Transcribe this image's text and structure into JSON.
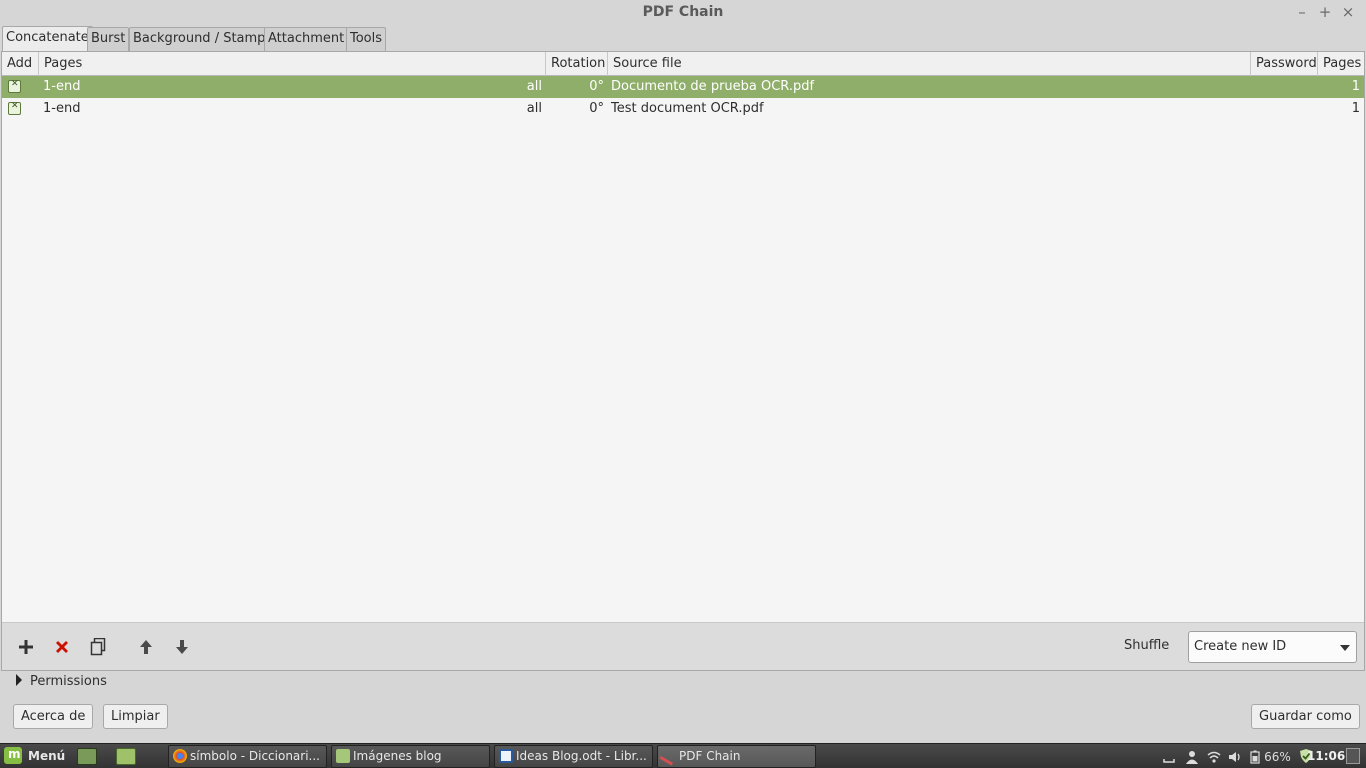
{
  "window": {
    "title": "PDF Chain",
    "minimize_glyph": "–",
    "maximize_glyph": "+",
    "close_glyph": "×"
  },
  "tabs": [
    {
      "label": "Concatenate"
    },
    {
      "label": "Burst"
    },
    {
      "label": "Background / Stamp"
    },
    {
      "label": "Attachment"
    },
    {
      "label": "Tools"
    }
  ],
  "table": {
    "columns": [
      "Add",
      "Pages",
      "Rotation",
      "Source file",
      "Password",
      "Pages"
    ],
    "rows": [
      {
        "pages": "1-end",
        "range": "all",
        "rotation": "0°",
        "source": "Documento de prueba OCR.pdf",
        "password": "",
        "page_count": "1",
        "selected": true
      },
      {
        "pages": "1-end",
        "range": "all",
        "rotation": "0°",
        "source": "Test document OCR.pdf",
        "password": "",
        "page_count": "1",
        "selected": false
      }
    ]
  },
  "toolbar": {
    "icons": [
      "add-icon",
      "remove-icon",
      "copy-icon",
      "move-up-icon",
      "move-down-icon"
    ],
    "shuffle_label": "Shuffle",
    "id_select_value": "Create new ID"
  },
  "permissions": {
    "label": "Permissions"
  },
  "buttons": {
    "about": "Acerca de",
    "clear": "Limpiar",
    "save": "Guardar como"
  },
  "taskbar": {
    "menu_label": "Menú",
    "tasks": [
      {
        "label": "símbolo - Diccionari..."
      },
      {
        "label": "Imágenes blog"
      },
      {
        "label": "Ideas Blog.odt - Libr..."
      },
      {
        "label": "PDF Chain"
      }
    ],
    "battery": "66%",
    "clock": "11:06"
  },
  "colors": {
    "selected_row": "#8fae69",
    "remove_icon": "#cc1100",
    "mint_green": "#86be43"
  }
}
